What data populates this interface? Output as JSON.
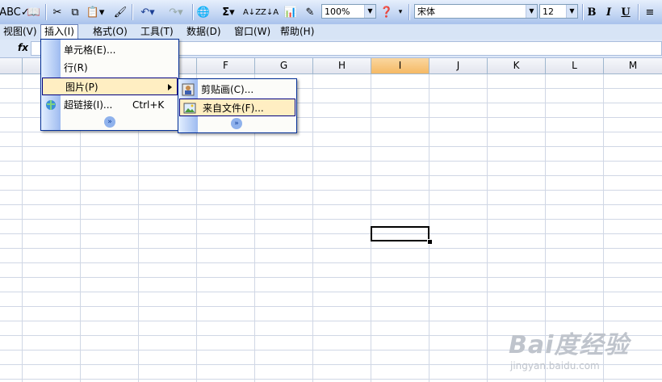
{
  "toolbar": {
    "zoom": "100%",
    "font_name": "宋体",
    "font_size": "12",
    "bold": "B",
    "italic": "I",
    "underline": "U",
    "sigma": "Σ"
  },
  "menubar": {
    "items": [
      "视图(V)",
      "插入(I)",
      "格式(O)",
      "工具(T)",
      "数据(D)",
      "窗口(W)",
      "帮助(H)"
    ]
  },
  "formula_bar": {
    "fx": "fx"
  },
  "columns": [
    "F",
    "G",
    "H",
    "I",
    "J",
    "K",
    "L",
    "M"
  ],
  "selected_column": "I",
  "insert_menu": {
    "items": [
      {
        "label": "单元格(E)..."
      },
      {
        "label": "行(R)"
      },
      {
        "label": "图片(P)"
      },
      {
        "label": "超链接(I)...",
        "shortcut": "Ctrl+K"
      }
    ]
  },
  "picture_submenu": {
    "items": [
      {
        "label": "剪贴画(C)..."
      },
      {
        "label": "来自文件(F)..."
      }
    ]
  },
  "watermark": {
    "text": "Bai度经验",
    "url": "jingyan.baidu.com"
  }
}
